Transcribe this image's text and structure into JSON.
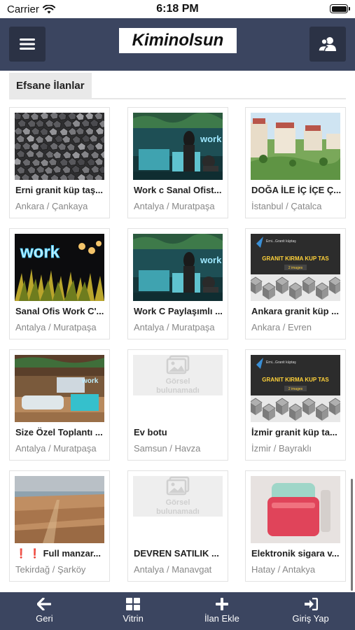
{
  "status_bar": {
    "carrier": "Carrier",
    "time": "6:18 PM"
  },
  "header": {
    "logo": "Kiminolsun"
  },
  "section": {
    "title": "Efsane İlanlar"
  },
  "listings": [
    {
      "title": "Erni granit küp taş...",
      "location": "Ankara / Çankaya",
      "image": "granite-cubes"
    },
    {
      "title": "Work c Sanal Ofist...",
      "location": "Antalya / Muratpaşa",
      "image": "office-reception"
    },
    {
      "title": "DOĞA İLE İÇ İÇE Ç...",
      "location": "İstanbul / Çatalca",
      "image": "apartment-complex"
    },
    {
      "title": "Sanal Ofis Work C'...",
      "location": "Antalya / Muratpaşa",
      "image": "work-neon-sign"
    },
    {
      "title": "Work C Paylaşımlı ...",
      "location": "Antalya / Muratpaşa",
      "image": "office-reception"
    },
    {
      "title": "Ankara granit küp ...",
      "location": "Ankara / Evren",
      "image": "granite-banner"
    },
    {
      "title": "Size Özel Toplantı ...",
      "location": "Antalya / Muratpaşa",
      "image": "meeting-room"
    },
    {
      "title": "Ev botu",
      "location": "Samsun / Havza",
      "image": "placeholder"
    },
    {
      "title": "İzmir granit küp ta...",
      "location": "İzmir / Bayraklı",
      "image": "granite-banner"
    },
    {
      "title": "❗ ❗ Full manzar...",
      "location": "Tekirdağ / Şarköy",
      "image": "land-plot"
    },
    {
      "title": "DEVREN SATILIK ...",
      "location": "Antalya / Manavgat",
      "image": "placeholder"
    },
    {
      "title": "Elektronik sigara v...",
      "location": "Hatay / Antakya",
      "image": "e-cigarette"
    }
  ],
  "placeholder": {
    "line1": "Görsel",
    "line2": "bulunamadı"
  },
  "banner": {
    "brand": "Erni...Granit küptaş",
    "tagline": "GRANIT KIRMA KUP TAS",
    "count": "2 images"
  },
  "neon": {
    "sign": "work"
  },
  "tabs": [
    {
      "label": "Geri",
      "icon": "arrow-left-icon"
    },
    {
      "label": "Vitrin",
      "icon": "grid-icon"
    },
    {
      "label": "İlan Ekle",
      "icon": "plus-icon"
    },
    {
      "label": "Giriş Yap",
      "icon": "login-icon"
    }
  ],
  "colors": {
    "nav": "#3b4560",
    "nav_button": "#2b3245",
    "section_tab": "#e9e9e9",
    "location_text": "#888888"
  }
}
